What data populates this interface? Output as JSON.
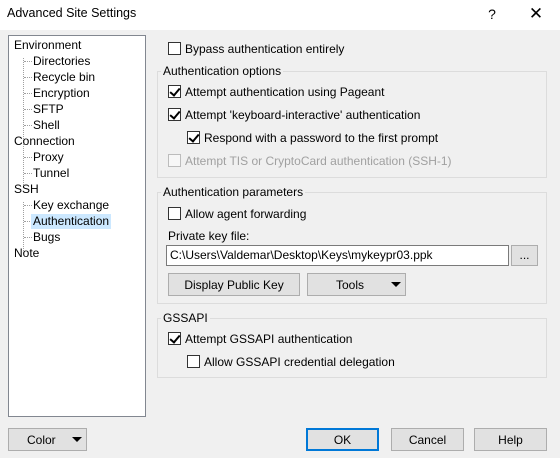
{
  "window": {
    "title": "Advanced Site Settings",
    "help_glyph": "?",
    "close_glyph": "✕"
  },
  "tree": {
    "items": [
      {
        "label": "Environment",
        "level": 0
      },
      {
        "label": "Directories",
        "level": 1
      },
      {
        "label": "Recycle bin",
        "level": 1
      },
      {
        "label": "Encryption",
        "level": 1
      },
      {
        "label": "SFTP",
        "level": 1
      },
      {
        "label": "Shell",
        "level": 1
      },
      {
        "label": "Connection",
        "level": 0
      },
      {
        "label": "Proxy",
        "level": 1
      },
      {
        "label": "Tunnel",
        "level": 1
      },
      {
        "label": "SSH",
        "level": 0
      },
      {
        "label": "Key exchange",
        "level": 1
      },
      {
        "label": "Authentication",
        "level": 1,
        "selected": true
      },
      {
        "label": "Bugs",
        "level": 1
      },
      {
        "label": "Note",
        "level": 0
      }
    ]
  },
  "bypass": {
    "label": "Bypass authentication entirely",
    "checked": false
  },
  "auth_options": {
    "title": "Authentication options",
    "pageant": {
      "label": "Attempt authentication using Pageant",
      "checked": true
    },
    "keyboard_interactive": {
      "label": "Attempt 'keyboard-interactive' authentication",
      "checked": true
    },
    "respond_password": {
      "label": "Respond with a password to the first prompt",
      "checked": true
    },
    "tis": {
      "label": "Attempt TIS or CryptoCard authentication (SSH-1)",
      "checked": false,
      "disabled": true
    }
  },
  "auth_params": {
    "title": "Authentication parameters",
    "agent_forwarding": {
      "label": "Allow agent forwarding",
      "checked": false
    },
    "private_key_label": "Private key file:",
    "private_key_value": "C:\\Users\\Valdemar\\Desktop\\Keys\\mykeypr03.ppk",
    "browse_label": "...",
    "display_key_label": "Display Public Key",
    "tools_label": "Tools"
  },
  "gssapi": {
    "title": "GSSAPI",
    "attempt": {
      "label": "Attempt GSSAPI authentication",
      "checked": true
    },
    "delegation": {
      "label": "Allow GSSAPI credential delegation",
      "checked": false
    }
  },
  "footer": {
    "color_label": "Color",
    "ok_label": "OK",
    "cancel_label": "Cancel",
    "help_label": "Help"
  },
  "colors": {
    "selection": "#cce8ff",
    "default_button_border": "#0078d7"
  }
}
